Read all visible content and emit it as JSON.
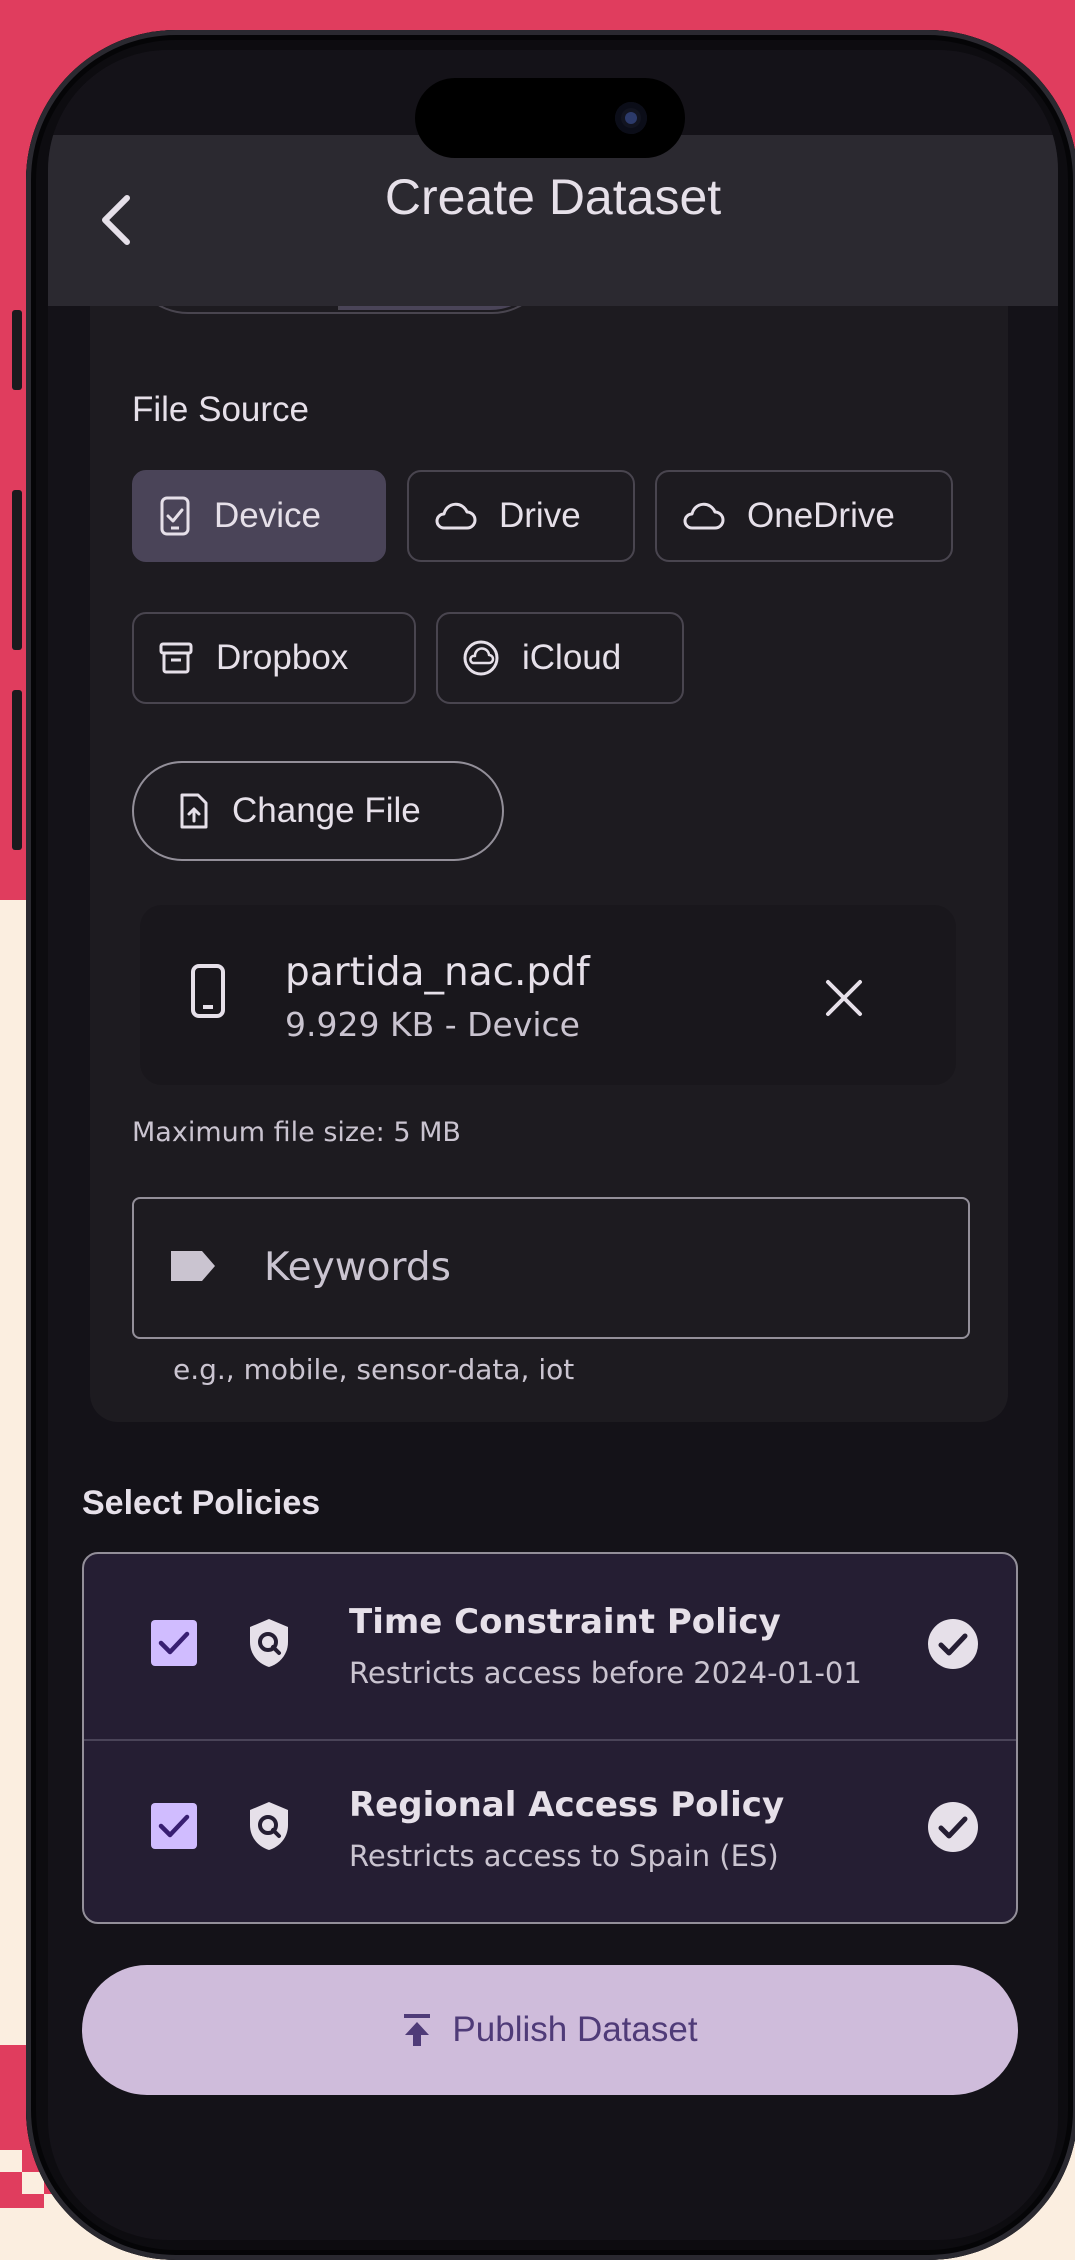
{
  "header": {
    "title": "Create Dataset"
  },
  "file_source": {
    "label": "File Source",
    "options": [
      {
        "label": "Device",
        "icon": "phone-check-icon",
        "selected": true
      },
      {
        "label": "Drive",
        "icon": "cloud-icon",
        "selected": false
      },
      {
        "label": "OneDrive",
        "icon": "cloud-icon",
        "selected": false
      },
      {
        "label": "Dropbox",
        "icon": "archive-box-icon",
        "selected": false
      },
      {
        "label": "iCloud",
        "icon": "icloud-icon",
        "selected": false
      }
    ]
  },
  "change_file_label": "Change File",
  "selected_file": {
    "name": "partida_nac.pdf",
    "meta": "9.929 KB - Device"
  },
  "max_size_hint": "Maximum file size: 5 MB",
  "keywords": {
    "label": "Keywords",
    "hint": "e.g., mobile, sensor-data, iot"
  },
  "policies": {
    "label": "Select Policies",
    "items": [
      {
        "title": "Time Constraint Policy",
        "subtitle": "Restricts access before 2024-01-01",
        "checked": true
      },
      {
        "title": "Regional Access Policy",
        "subtitle": "Restricts access to Spain (ES)",
        "checked": true
      }
    ]
  },
  "publish_label": "Publish Dataset",
  "colors": {
    "brand_pink": "#e03d5e",
    "background_cream": "#fbeee0",
    "surface": "#141218",
    "selected_chip": "#4a4458",
    "policies_panel": "#251e33",
    "checkbox": "#d0bcff",
    "publish_button": "#cfbcdb",
    "publish_text": "#4f3b78"
  }
}
